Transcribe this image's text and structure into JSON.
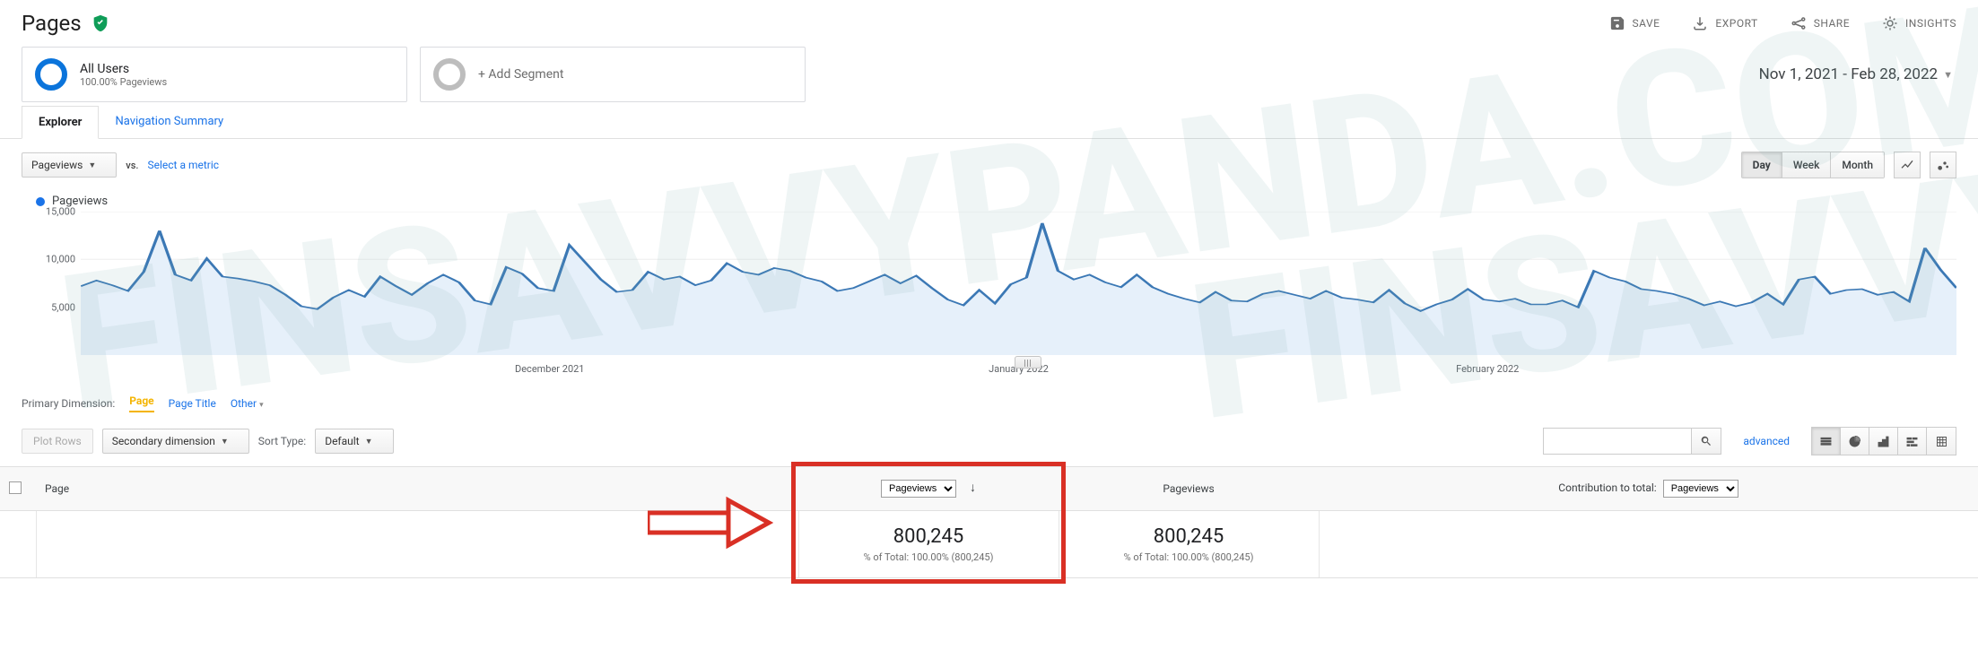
{
  "watermark": "FINSAVVYPANDA.COM",
  "header": {
    "title": "Pages",
    "toolbar": {
      "save": "SAVE",
      "export": "EXPORT",
      "share": "SHARE",
      "insights": "INSIGHTS"
    }
  },
  "segments": {
    "primary": {
      "title": "All Users",
      "subtitle": "100.00% Pageviews"
    },
    "add": "+ Add Segment",
    "date_range": "Nov 1, 2021 - Feb 28, 2022"
  },
  "tabs": {
    "explorer": "Explorer",
    "nav_summary": "Navigation Summary"
  },
  "metric_row": {
    "primary_select": "Pageviews",
    "vs": "vs.",
    "select_metric": "Select a metric",
    "granularity": {
      "day": "Day",
      "week": "Week",
      "month": "Month"
    }
  },
  "chart_legend": {
    "label": "Pageviews"
  },
  "chart_data": {
    "type": "area",
    "title": "",
    "xlabel": "",
    "ylabel": "",
    "ylim": [
      0,
      15000
    ],
    "y_ticks": [
      5000,
      10000,
      15000
    ],
    "x_ticks": [
      "December 2021",
      "January 2022",
      "February 2022"
    ],
    "series": [
      {
        "name": "Pageviews",
        "values": [
          7200,
          7800,
          7300,
          6700,
          8700,
          13000,
          8400,
          7800,
          10100,
          8200,
          8000,
          7700,
          7300,
          6300,
          5100,
          4800,
          6000,
          6800,
          6100,
          8200,
          7200,
          6300,
          7500,
          8400,
          7600,
          5700,
          5300,
          9200,
          8500,
          7000,
          6700,
          11500,
          9700,
          7900,
          6600,
          6800,
          8700,
          7900,
          8200,
          7300,
          7800,
          9600,
          8700,
          8400,
          9100,
          8800,
          8100,
          7700,
          6700,
          7000,
          7700,
          8400,
          7500,
          8300,
          7000,
          5800,
          5200,
          6800,
          5400,
          7400,
          8100,
          13800,
          8800,
          7900,
          8400,
          7600,
          7100,
          8400,
          7100,
          6400,
          5900,
          5500,
          6600,
          5700,
          5600,
          6400,
          6700,
          6300,
          5900,
          6700,
          6000,
          5800,
          5500,
          6800,
          5400,
          4600,
          5300,
          5800,
          6900,
          5800,
          5600,
          5900,
          5300,
          5300,
          5700,
          5000,
          8800,
          8100,
          7700,
          6900,
          6700,
          6400,
          5900,
          5200,
          5600,
          5100,
          5500,
          6400,
          5300,
          7900,
          8200,
          6400,
          6800,
          6900,
          6300,
          6600,
          5600,
          11200,
          8900,
          7000
        ]
      }
    ]
  },
  "primary_dimension": {
    "label": "Primary Dimension:",
    "items": [
      "Page",
      "Page Title",
      "Other"
    ]
  },
  "table_controls": {
    "plot_rows": "Plot Rows",
    "secondary_dim": "Secondary dimension",
    "sort_type_label": "Sort Type:",
    "sort_type_value": "Default",
    "advanced": "advanced"
  },
  "table": {
    "columns": {
      "page": "Page",
      "pageviews_select": "Pageviews",
      "pageviews_label": "Pageviews",
      "contribution_label": "Contribution to total:",
      "contribution_select": "Pageviews"
    },
    "totals": {
      "pv1_value": "800,245",
      "pv1_sub": "% of Total: 100.00% (800,245)",
      "pv2_value": "800,245",
      "pv2_sub": "% of Total: 100.00% (800,245)"
    }
  }
}
